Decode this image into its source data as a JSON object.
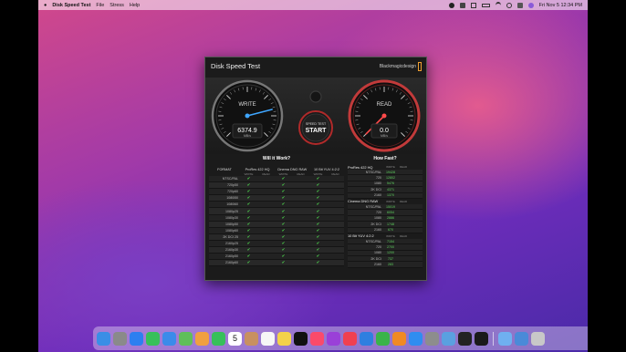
{
  "menubar": {
    "apple": "",
    "app": "Disk Speed Test",
    "items": [
      "File",
      "Stress",
      "Help"
    ],
    "clock": "Fri Nov 5  12:34 PM"
  },
  "window": {
    "title": "Disk Speed Test",
    "brand": "Blackmagicdesign"
  },
  "gauges": {
    "write": {
      "label": "WRITE",
      "value": "6374.9",
      "unit": "MB/s",
      "level": 0.78
    },
    "read": {
      "label": "READ",
      "value": "0.0",
      "unit": "MB/s",
      "level": 0.0
    },
    "start": {
      "line1": "SPEED TEST",
      "line2": "START"
    }
  },
  "will_it_work": {
    "title": "Will it Work?",
    "format_col": "FORMAT",
    "codecs": [
      "ProRes 422 HQ",
      "Cinema DNG RAW",
      "10 Bit YUV 4:2:2"
    ],
    "sub_write": "WRITE",
    "sub_read": "READ",
    "rows": [
      "NTSC/PAL",
      "720p50",
      "720p60",
      "1080i50",
      "1080i60",
      "1080p25",
      "1080p30",
      "1080p50",
      "1080p60",
      "2K DCI 25",
      "2160p25",
      "2160p30",
      "2160p50",
      "2160p60"
    ],
    "check": "✔"
  },
  "how_fast": {
    "title": "How Fast?",
    "col_write": "WRITE",
    "col_read": "READ",
    "groups": [
      {
        "name": "ProRes 422 HQ",
        "rows": [
          {
            "label": "NTSC/PAL",
            "write": "19428"
          },
          {
            "label": "720",
            "write": "12802"
          },
          {
            "label": "1080",
            "write": "5476"
          },
          {
            "label": "2K DCI",
            "write": "4371"
          },
          {
            "label": "2160",
            "write": "1370"
          }
        ]
      },
      {
        "name": "Cinema DNG RAW",
        "rows": [
          {
            "label": "NTSC/PAL",
            "write": "15019"
          },
          {
            "label": "720",
            "write": "6054"
          },
          {
            "label": "1080",
            "write": "2886"
          },
          {
            "label": "2K DCI",
            "write": "1748"
          },
          {
            "label": "2160",
            "write": "670"
          }
        ]
      },
      {
        "name": "10 Bit YUV 4:2:2",
        "rows": [
          {
            "label": "NTSC/PAL",
            "write": "7154"
          },
          {
            "label": "720",
            "write": "2700"
          },
          {
            "label": "1080",
            "write": "1200"
          },
          {
            "label": "2K DCI",
            "write": "737"
          },
          {
            "label": "2160",
            "write": "283"
          }
        ]
      }
    ]
  },
  "dock": {
    "icons": [
      "finder-icon",
      "launchpad-icon",
      "safari-icon",
      "messages-icon",
      "mail-icon",
      "maps-icon",
      "photos-icon",
      "facetime-icon",
      "calendar-icon",
      "contacts-icon",
      "reminders-icon",
      "notes-icon",
      "tv-icon",
      "music-icon",
      "podcasts-icon",
      "news-icon",
      "keynote-icon",
      "numbers-icon",
      "pages-icon",
      "appstore-icon",
      "settings-icon",
      "preview-icon",
      "quicktime-icon",
      "diskspeed-icon",
      "finder2-icon",
      "downloads-icon",
      "trash-icon"
    ],
    "colors": [
      "#3a8ee6",
      "#8a8a8a",
      "#2d7ff0",
      "#37c05a",
      "#3b8bea",
      "#5fbf5a",
      "#f0a040",
      "#37c05a",
      "#ffffff",
      "#c89060",
      "#f6f6f6",
      "#f3d24a",
      "#111111",
      "#fa4a6a",
      "#9a40d8",
      "#f04050",
      "#2f7fe0",
      "#3ab34a",
      "#f08a24",
      "#2f8df0",
      "#8d8d8d",
      "#5aa0e0",
      "#222222",
      "#1a1a1a",
      "#6fb0f0",
      "#4a8ad8",
      "#c8c8c8"
    ],
    "calendar_day": "5"
  }
}
